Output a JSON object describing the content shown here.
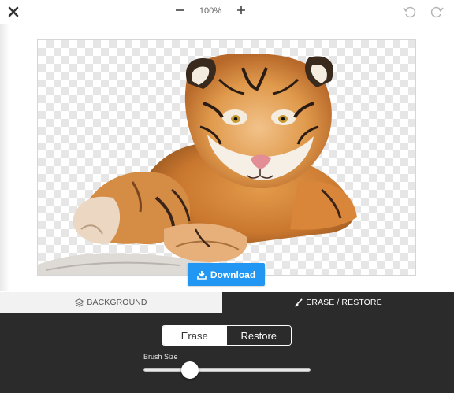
{
  "toolbar": {
    "close_icon": "close-icon",
    "zoom_out_icon": "minus-icon",
    "zoom_level": "100%",
    "zoom_in_icon": "plus-icon",
    "undo_icon": "undo-icon",
    "redo_icon": "redo-icon"
  },
  "canvas": {
    "background": "transparent-checkerboard",
    "subject": "tiger with background removed"
  },
  "download": {
    "label": "Download",
    "icon": "download-icon"
  },
  "tabs": [
    {
      "label": "BACKGROUND",
      "icon": "layers-icon",
      "active": false
    },
    {
      "label": "ERASE / RESTORE",
      "icon": "brush-icon",
      "active": true
    }
  ],
  "mode": {
    "erase_label": "Erase",
    "restore_label": "Restore",
    "selected": "Erase"
  },
  "brush": {
    "label": "Brush Size",
    "value_fraction": 0.28
  },
  "colors": {
    "accent": "#2196f3",
    "panel": "#2b2b2b",
    "tab_inactive": "#f2f2f2"
  }
}
